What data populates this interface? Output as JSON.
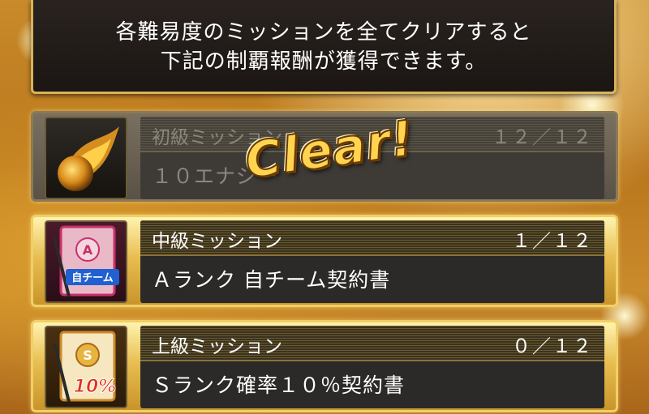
{
  "header": {
    "line1": "各難易度のミッションを全てクリアすると",
    "line2": "下記の制覇報酬が獲得できます。"
  },
  "missions": [
    {
      "title": "初級ミッション",
      "count": "１２／１２",
      "reward": "１０エナジー",
      "icon": "flame-ball-icon",
      "cleared": true
    },
    {
      "title": "中級ミッション",
      "count": "１／１２",
      "reward": "Ａランク 自チーム契約書",
      "icon": "a-rank-contract-icon",
      "icon_text": "自チーム",
      "cleared": false
    },
    {
      "title": "上級ミッション",
      "count": "０／１２",
      "reward": "Ｓランク確率１０％契約書",
      "icon": "s-rank-contract-icon",
      "icon_text": "10%",
      "cleared": false
    }
  ],
  "clear_stamp": "Clear!",
  "colors": {
    "gold_border": "#f0cf66",
    "panel_dark": "#2c2a28",
    "stamp": "#ffd450"
  }
}
